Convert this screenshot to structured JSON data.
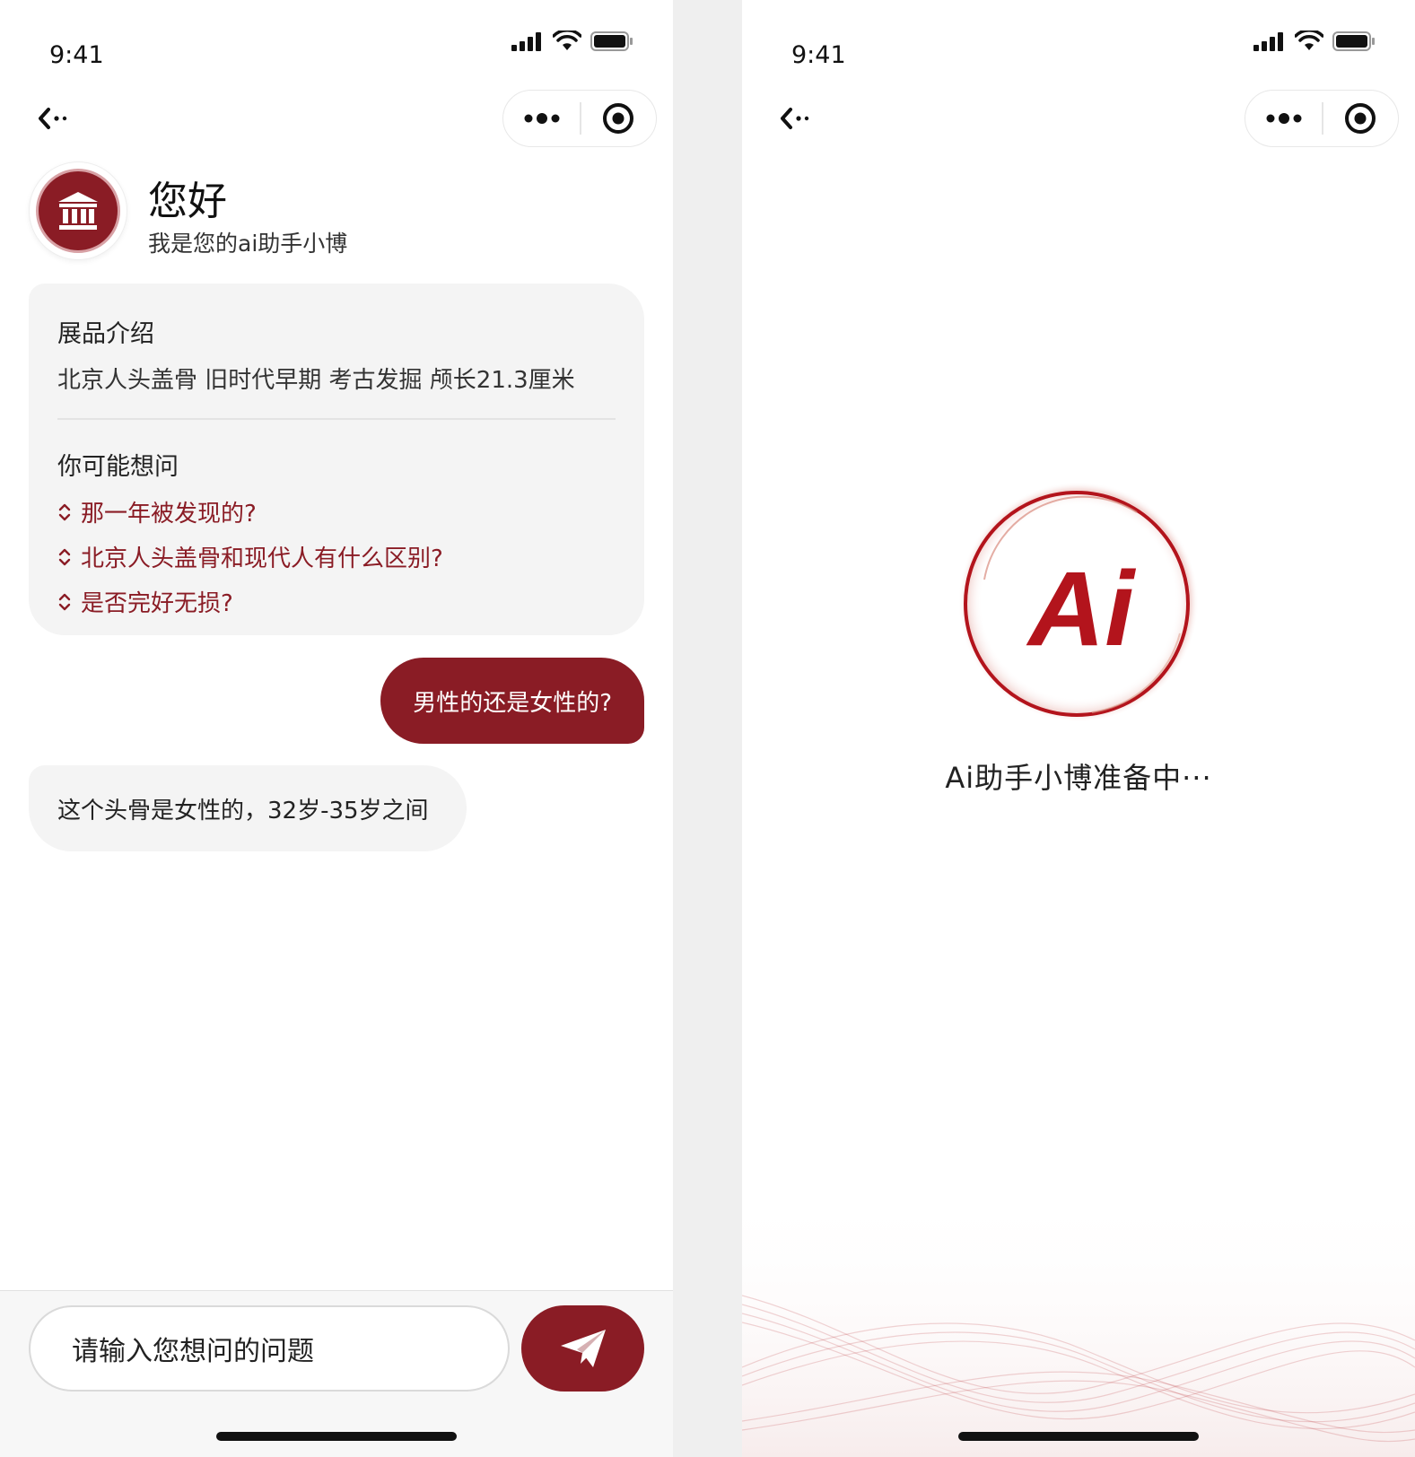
{
  "colors": {
    "accent": "#8a1c25",
    "bubble_gray": "#f4f4f4"
  },
  "status_bar": {
    "time": "9:41"
  },
  "left_screen": {
    "header": {
      "title": "您好",
      "subtitle": "我是您的ai助手小博",
      "avatar_icon": "museum-icon"
    },
    "card": {
      "intro_heading": "展品介绍",
      "intro_text": "北京人头盖骨  旧时代早期 考古发掘 颅长21.3厘米",
      "suggest_heading": "你可能想问",
      "suggestions": [
        {
          "label": "那一年被发现的?"
        },
        {
          "label": "北京人头盖骨和现代人有什么区别?"
        },
        {
          "label": "是否完好无损?"
        }
      ]
    },
    "messages": {
      "user": "男性的还是女性的?",
      "bot": "这个头骨是女性的，32岁-35岁之间"
    },
    "input": {
      "placeholder": "请输入您想问的问题",
      "send_icon": "paper-plane-icon"
    }
  },
  "right_screen": {
    "logo_text": "Ai",
    "loading_text": "Ai助手小博准备中···"
  }
}
